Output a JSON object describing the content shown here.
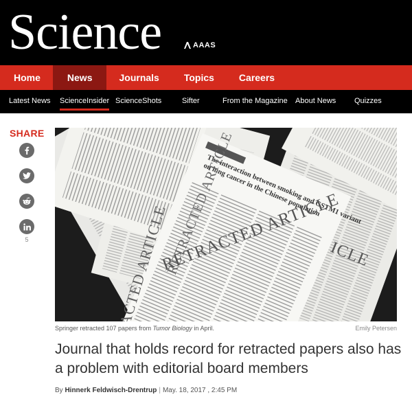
{
  "brand": {
    "logo_text": "Science",
    "publisher": "AAAS"
  },
  "main_nav": [
    "Home",
    "News",
    "Journals",
    "Topics",
    "Careers"
  ],
  "main_nav_active": "News",
  "sub_nav": [
    "Latest News",
    "ScienceInsider",
    "ScienceShots",
    "Sifter",
    "From the Magazine",
    "About News",
    "Quizzes"
  ],
  "sub_nav_active": "ScienceInsider",
  "share": {
    "title": "SHARE",
    "buttons": [
      "facebook-icon",
      "twitter-icon",
      "reddit-icon",
      "linkedin-icon"
    ],
    "count": "5"
  },
  "photo": {
    "stamp": "RETRACTED ARTICLE",
    "paper_title": "The interaction between smoking and GSTM1 variant on lung cancer in the Chinese population"
  },
  "caption": {
    "text_before": "Springer retracted 107 papers from ",
    "journal": "Tumor Biology",
    "text_after": " in April.",
    "credit": "Emily Petersen"
  },
  "article": {
    "headline": "Journal that holds record for retracted papers also has a problem with editorial board members",
    "by": "By",
    "author": "Hinnerk Feldwisch-Drentrup",
    "separator": "|",
    "date": "May. 18, 2017 , 2:45 PM"
  },
  "colors": {
    "brand_red": "#d52b1e",
    "active_red": "#8c1812",
    "black": "#000000"
  }
}
